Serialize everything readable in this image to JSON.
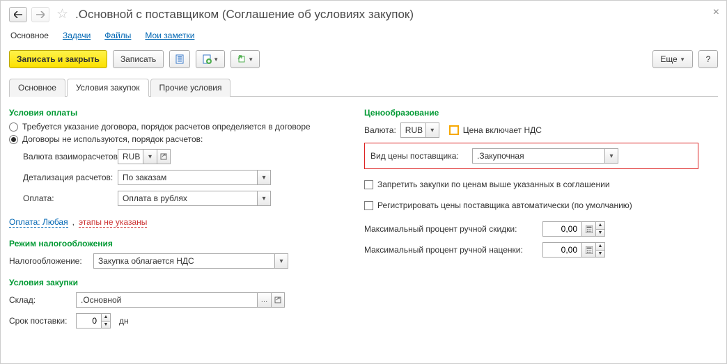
{
  "title": ".Основной с поставщиком (Соглашение об условиях закупок)",
  "nav": {
    "main": "Основное",
    "tasks": "Задачи",
    "files": "Файлы",
    "notes": "Мои заметки"
  },
  "toolbar": {
    "save_close": "Записать и закрыть",
    "save": "Записать",
    "more": "Еще",
    "help": "?"
  },
  "tabs": {
    "t0": "Основное",
    "t1": "Условия закупок",
    "t2": "Прочие условия"
  },
  "left": {
    "sec_payment": "Условия оплаты",
    "radio1": "Требуется указание договора, порядок расчетов определяется в договоре",
    "radio2": "Договоры не используются, порядок расчетов:",
    "lbl_currency": "Валюта взаиморасчетов:",
    "currency": "RUB",
    "lbl_detail": "Детализация расчетов:",
    "detail": "По заказам",
    "lbl_pay": "Оплата:",
    "pay": "Оплата в рублях",
    "link_pay": "Оплата: Любая",
    "link_sep": ", ",
    "link_stages": "этапы не указаны",
    "sec_tax": "Режим налогообложения",
    "lbl_tax": "Налогообложение:",
    "tax": "Закупка облагается НДС",
    "sec_purchase": "Условия закупки",
    "lbl_wh": "Склад:",
    "wh": ".Основной",
    "lbl_term": "Срок поставки:",
    "term_val": "0",
    "term_unit": "дн"
  },
  "right": {
    "sec_pricing": "Ценообразование",
    "lbl_currency": "Валюта:",
    "currency": "RUB",
    "chk_vat": "Цена включает НДС",
    "lbl_price_type": "Вид цены поставщика:",
    "price_type": ".Закупочная",
    "chk_forbid": "Запретить закупки по ценам выше указанных в соглашении",
    "chk_register": "Регистрировать цены поставщика автоматически (по умолчанию)",
    "lbl_disc": "Максимальный процент ручной скидки:",
    "disc_val": "0,00",
    "lbl_markup": "Максимальный процент ручной наценки:",
    "markup_val": "0,00"
  }
}
